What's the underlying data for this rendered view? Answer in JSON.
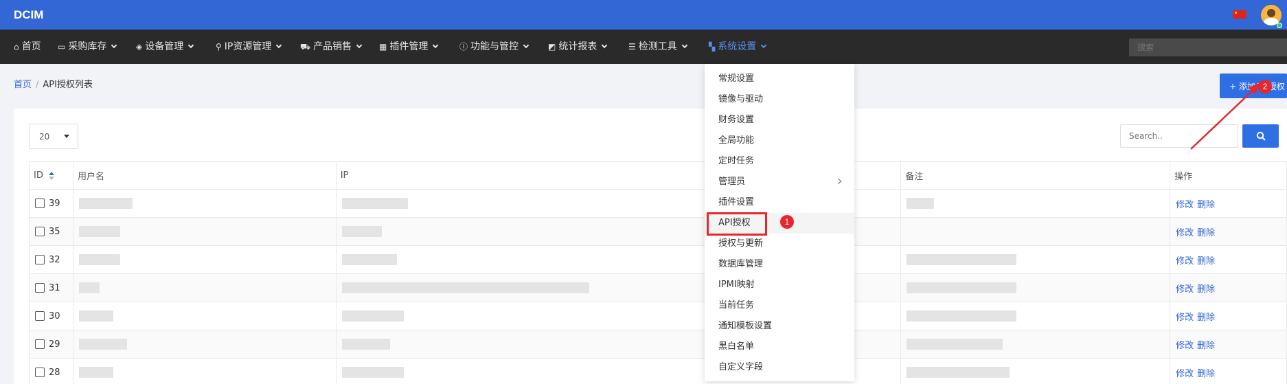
{
  "app": {
    "brand": "DCIM"
  },
  "nav": {
    "items": [
      {
        "label": "首页",
        "icon": "home-icon",
        "glyph": "⌂"
      },
      {
        "label": "采购库存",
        "icon": "inbox-icon",
        "glyph": "▭"
      },
      {
        "label": "设备管理",
        "icon": "cube-icon",
        "glyph": "◈"
      },
      {
        "label": "IP资源管理",
        "icon": "map-marker-icon",
        "glyph": "⚲"
      },
      {
        "label": "产品销售",
        "icon": "cart-icon",
        "glyph": "⛟"
      },
      {
        "label": "插件管理",
        "icon": "grid-icon",
        "glyph": "▦"
      },
      {
        "label": "功能与管控",
        "icon": "info-icon",
        "glyph": "ⓘ"
      },
      {
        "label": "统计报表",
        "icon": "chart-icon",
        "glyph": "◩"
      },
      {
        "label": "检测工具",
        "icon": "list-icon",
        "glyph": "☰"
      },
      {
        "label": "系统设置",
        "icon": "th-large-icon",
        "glyph": "▚"
      }
    ],
    "search_placeholder": "搜索"
  },
  "breadcrumb": {
    "home": "首页",
    "sep": "/",
    "current": "API授权列表"
  },
  "add_button": {
    "label": "+ 添加API授权"
  },
  "toolbar": {
    "page_size": "20",
    "search_placeholder": "Search.."
  },
  "table": {
    "headers": {
      "id": "ID",
      "username": "用户名",
      "ip": "IP",
      "remark": "备注",
      "actions": "操作"
    },
    "rows": [
      {
        "id": "39",
        "edit": "修改",
        "delete": "删除"
      },
      {
        "id": "35",
        "edit": "修改",
        "delete": "删除"
      },
      {
        "id": "32",
        "edit": "修改",
        "delete": "删除"
      },
      {
        "id": "31",
        "edit": "修改",
        "delete": "删除"
      },
      {
        "id": "30",
        "edit": "修改",
        "delete": "删除"
      },
      {
        "id": "29",
        "edit": "修改",
        "delete": "删除"
      },
      {
        "id": "28",
        "edit": "修改",
        "delete": "删除"
      }
    ]
  },
  "dropdown": {
    "items": [
      {
        "label": "常规设置"
      },
      {
        "label": "镜像与驱动"
      },
      {
        "label": "财务设置"
      },
      {
        "label": "全局功能"
      },
      {
        "label": "定时任务"
      },
      {
        "label": "管理员",
        "has_submenu": true
      },
      {
        "label": "插件设置"
      },
      {
        "label": "API授权",
        "highlighted": true
      },
      {
        "label": "授权与更新"
      },
      {
        "label": "数据库管理"
      },
      {
        "label": "IPMI映射"
      },
      {
        "label": "当前任务"
      },
      {
        "label": "通知模板设置"
      },
      {
        "label": "黑白名单"
      },
      {
        "label": "自定义字段"
      }
    ]
  },
  "annotations": {
    "step1": "1",
    "step2": "2"
  },
  "colors": {
    "topbar": "#3367d6",
    "navbar": "#2a2a2a",
    "accent": "#2f6fe4",
    "highlight": "#e8262b"
  }
}
